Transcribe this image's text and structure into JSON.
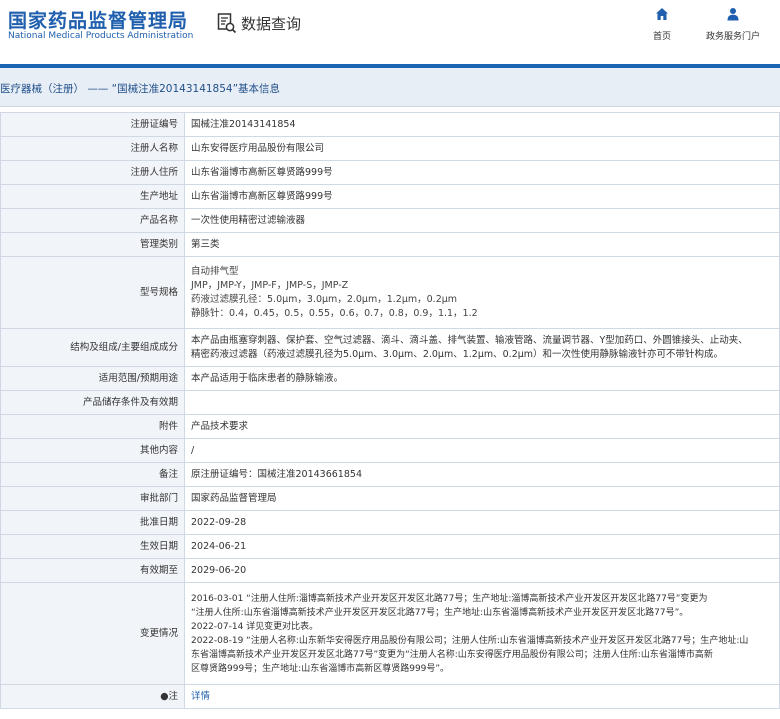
{
  "header": {
    "logo_cn": "国家药品监督管理局",
    "logo_en": "National Medical Products Administration",
    "query_label": "数据查询",
    "nav": [
      {
        "label": "首页",
        "icon": "home-icon"
      },
      {
        "label": "政务服务门户",
        "icon": "user-icon"
      }
    ]
  },
  "breadcrumb": "医疗器械（注册） —— “国械注准20143141854”基本信息",
  "rows": [
    {
      "label": "注册证编号",
      "value": "国械注准20143141854"
    },
    {
      "label": "注册人名称",
      "value": "山东安得医疗用品股份有限公司"
    },
    {
      "label": "注册人住所",
      "value": "山东省淄博市高新区尊贤路999号"
    },
    {
      "label": "生产地址",
      "value": "山东省淄博市高新区尊贤路999号"
    },
    {
      "label": "产品名称",
      "value": "一次性使用精密过滤输液器"
    },
    {
      "label": "管理类别",
      "value": "第三类"
    },
    {
      "label": "型号规格",
      "lines": [
        "自动排气型",
        "JMP，JMP-Y，JMP-F，JMP-S，JMP-Z",
        "药液过滤膜孔径：5.0μm，3.0μm，2.0μm，1.2μm，0.2μm",
        "静脉针：0.4，0.45，0.5，0.55，0.6，0.7，0.8，0.9，1.1，1.2"
      ]
    },
    {
      "label": "结构及组成/主要组成成分",
      "lines": [
        "本产品由瓶塞穿刺器、保护套、空气过滤器、滴斗、滴斗盖、排气装置、输液管路、流量调节器、Y型加药口、外圆锥接头、止动夹、",
        "精密药液过滤器（药液过滤膜孔径为5.0μm、3.0μm、2.0μm、1.2μm、0.2μm）和一次性使用静脉输液针亦可不带针构成。"
      ]
    },
    {
      "label": "适用范围/预期用途",
      "value": "本产品适用于临床患者的静脉输液。"
    },
    {
      "label": "产品储存条件及有效期",
      "value": ""
    },
    {
      "label": "附件",
      "value": "产品技术要求"
    },
    {
      "label": "其他内容",
      "value": "/"
    },
    {
      "label": "备注",
      "value": "原注册证编号：国械注准20143661854"
    },
    {
      "label": "审批部门",
      "value": "国家药品监督管理局"
    },
    {
      "label": "批准日期",
      "value": "2022-09-28"
    },
    {
      "label": "生效日期",
      "value": "2024-06-21"
    },
    {
      "label": "有效期至",
      "value": "2029-06-20"
    },
    {
      "label": "变更情况",
      "lines": [
        "2016-03-01 “注册人住所:淄博高新技术产业开发区开发区北路77号；生产地址:淄博高新技术产业开发区开发区北路77号”变更为",
        "“注册人住所:山东省淄博高新技术产业开发区开发区北路77号；生产地址:山东省淄博高新技术产业开发区开发区北路77号”。",
        "2022-07-14 详见变更对比表。",
        "2022-08-19 “注册人名称:山东新华安得医疗用品股份有限公司；注册人住所:山东省淄博高新技术产业开发区开发区北路77号；生产地址:山",
        "东省淄博高新技术产业开发区开发区北路77号”变更为“注册人名称:山东安得医疗用品股份有限公司；注册人住所:山东省淄博市高新",
        "区尊贤路999号；生产地址:山东省淄博市高新区尊贤路999号”。"
      ]
    },
    {
      "label": "●注",
      "value": "详情",
      "link": true
    }
  ]
}
